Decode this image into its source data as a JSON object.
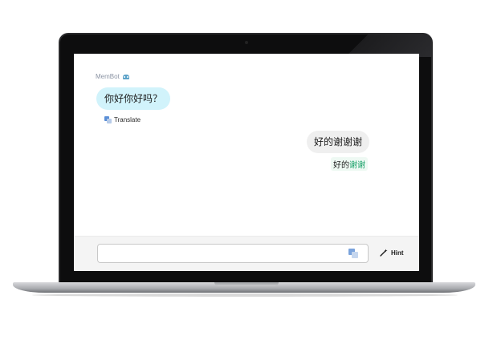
{
  "chat": {
    "bot_name": "MemBot",
    "bot_message": "你好你好吗？",
    "translate_label": "Translate",
    "user_message": "好的谢谢谢",
    "correction": {
      "kept": "好的",
      "fixed": "谢谢"
    }
  },
  "input": {
    "value": "",
    "placeholder": ""
  },
  "hint": {
    "label": "Hint"
  },
  "colors": {
    "bot_bubble": "#d1f3fb",
    "user_bubble": "#efefef",
    "correction_highlight": "#16a067",
    "translate_icon": "#5b8fd6"
  },
  "icons": [
    "bot-icon",
    "translate-icon",
    "wand-icon"
  ]
}
